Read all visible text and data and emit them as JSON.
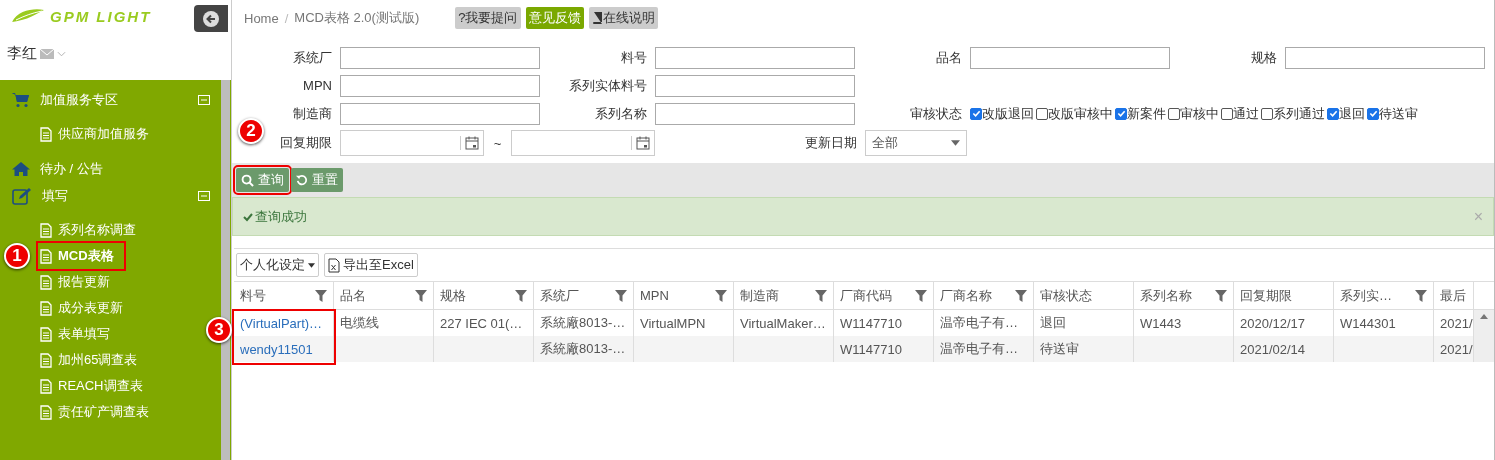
{
  "sidebar": {
    "logo": "GPM LIGHT",
    "user": "李红",
    "menu": [
      {
        "label": "加值服务专区",
        "kind": "cart",
        "expanded": true,
        "children": [
          {
            "label": "供应商加值服务",
            "selected": false
          }
        ]
      },
      {
        "label": "待办 / 公告",
        "kind": "home"
      },
      {
        "label": "填写",
        "kind": "edit",
        "expanded": true,
        "children": [
          {
            "label": "系列名称调查",
            "selected": false
          },
          {
            "label": "MCD表格",
            "selected": true,
            "callout": "1"
          },
          {
            "label": "报告更新",
            "selected": false
          },
          {
            "label": "成分表更新",
            "selected": false
          },
          {
            "label": "表单填写",
            "selected": false
          },
          {
            "label": "加州65调查表",
            "selected": false
          },
          {
            "label": "REACH调查表",
            "selected": false
          },
          {
            "label": "责任矿产调查表",
            "selected": false
          }
        ]
      }
    ]
  },
  "breadcrumb": {
    "items": [
      "Home",
      "MCD表格 2.0(测试版)"
    ],
    "separator": "/"
  },
  "header_buttons": [
    {
      "label": "?我要提问",
      "kind": "plain"
    },
    {
      "label": "意见反馈",
      "kind": "primary"
    },
    {
      "label": "在线说明",
      "kind": "book"
    }
  ],
  "form": {
    "rows": [
      [
        {
          "label": "系统厂",
          "kind": "text"
        },
        {
          "label": "料号",
          "kind": "text"
        },
        {
          "label": "品名",
          "kind": "text"
        },
        {
          "label": "规格",
          "kind": "text"
        }
      ],
      [
        {
          "label": "MPN",
          "kind": "text"
        },
        {
          "label": "系列实体料号",
          "kind": "text"
        }
      ],
      [
        {
          "label": "制造商",
          "kind": "text"
        },
        {
          "label": "系列名称",
          "kind": "text"
        },
        {
          "label": "审核状态",
          "kind": "checks",
          "options": [
            {
              "label": "改版退回",
              "checked": true
            },
            {
              "label": "改版审核中",
              "checked": false
            },
            {
              "label": "新案件",
              "checked": true
            },
            {
              "label": "审核中",
              "checked": false
            },
            {
              "label": "通过",
              "checked": false
            },
            {
              "label": "系列通过",
              "checked": false
            },
            {
              "label": "退回",
              "checked": true
            },
            {
              "label": "待送审",
              "checked": true
            }
          ]
        }
      ],
      [
        {
          "label": "回复期限",
          "kind": "daterange",
          "separator": "~"
        },
        {
          "label": "更新日期",
          "kind": "select",
          "value": "全部"
        }
      ]
    ]
  },
  "actions": [
    {
      "label": "查询",
      "kind": "search",
      "callout": "2"
    },
    {
      "label": "重置",
      "kind": "reset"
    }
  ],
  "alert": {
    "message": "查询成功",
    "close": "×"
  },
  "grid": {
    "toolbar": [
      {
        "label": "个人化设定",
        "kind": "menu"
      },
      {
        "label": "导出至Excel",
        "kind": "excel"
      }
    ],
    "callout": "3",
    "columns": [
      {
        "label": "料号",
        "filter": true
      },
      {
        "label": "品名",
        "filter": true
      },
      {
        "label": "规格",
        "filter": true
      },
      {
        "label": "系统厂",
        "filter": true
      },
      {
        "label": "MPN",
        "filter": true
      },
      {
        "label": "制造商",
        "filter": true
      },
      {
        "label": "厂商代码",
        "filter": true
      },
      {
        "label": "厂商名称",
        "filter": true
      },
      {
        "label": "审核状态",
        "filter": false
      },
      {
        "label": "系列名称",
        "filter": true
      },
      {
        "label": "回复期限",
        "filter": false
      },
      {
        "label": "系列实…",
        "filter": true
      },
      {
        "label": "最后",
        "filter": false
      }
    ],
    "rows": [
      [
        "(VirtualPart)…",
        "电缆线",
        "227 IEC 01(…",
        "系統廠8013-…",
        "VirtualMPN",
        "VirtualMaker…",
        "W1147710",
        "温帝电子有…",
        "退回",
        "W1443",
        "2020/12/17",
        "W144301",
        "2021/"
      ],
      [
        "wendy11501",
        "",
        "",
        "系統廠8013-…",
        "",
        "",
        "W1147710",
        "温帝电子有…",
        "待送审",
        "",
        "2021/02/14",
        "",
        "2021/"
      ]
    ]
  }
}
